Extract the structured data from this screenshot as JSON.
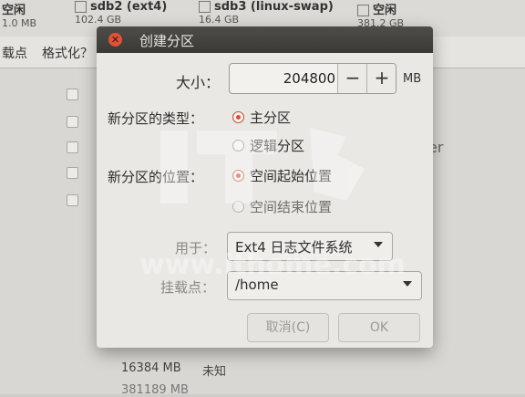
{
  "background": {
    "partitions": [
      {
        "name": "空闲",
        "size": "1.0 MB"
      },
      {
        "name": "sdb2 (ext4)",
        "size": "102.4 GB"
      },
      {
        "name": "sdb3 (linux-swap)",
        "size": "16.4 GB"
      },
      {
        "name": "空闲",
        "size": "381.2 GB"
      }
    ],
    "columns": [
      "载点",
      "格式化？"
    ],
    "bottom_row": {
      "size": "16384 MB",
      "type": "未知"
    },
    "bottom_row2": "381189 MB",
    "right_fragment": "er"
  },
  "dialog": {
    "title": "创建分区",
    "size_label": "大小：",
    "size_value": "204800",
    "size_minus": "−",
    "size_plus": "+",
    "size_unit": "MB",
    "type_label": "新分区的类型：",
    "type_options": [
      {
        "label": "主分区",
        "selected": true
      },
      {
        "label": "逻辑分区",
        "selected": false
      }
    ],
    "location_label": "新分区的位置：",
    "location_options": [
      {
        "label": "空间起始位置",
        "selected": true
      },
      {
        "label": "空间结束位置",
        "selected": false
      }
    ],
    "use_as_label": "用于：",
    "use_as_value": "Ext4 日志文件系统",
    "mount_label": "挂载点：",
    "mount_value": "/home",
    "cancel_label": "取消(C)",
    "ok_label": "OK"
  },
  "watermark": {
    "text": "www.ithome.com",
    "logo": "IT之家"
  },
  "colors": {
    "accent": "#d4502f",
    "titlebar": "#3f3e3a",
    "close": "#e0523a"
  }
}
